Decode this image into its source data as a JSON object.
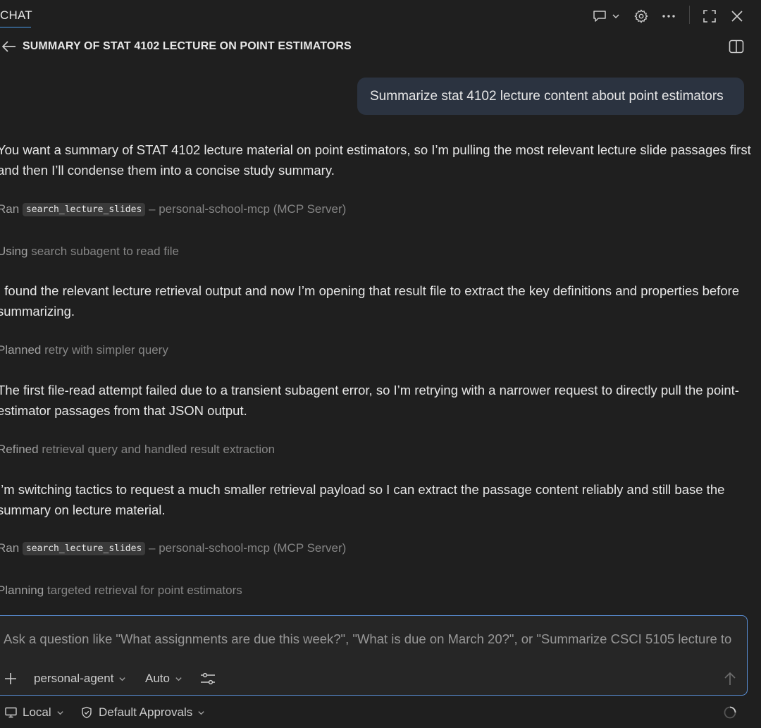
{
  "header": {
    "tab_label": "CHAT",
    "icons": [
      "chat-feedback-icon",
      "chevron-down-icon",
      "gear-icon",
      "more-icon",
      "fullscreen-icon",
      "close-icon"
    ]
  },
  "conversation": {
    "title": "SUMMARY OF STAT 4102 LECTURE ON POINT ESTIMATORS",
    "user_message": "Summarize stat 4102 lecture content about point estimators",
    "messages": [
      "You want a summary of STAT 4102 lecture material on point estimators, so I’m pulling the most relevant lecture slide passages first and then I’ll condense them into a concise study summary.",
      "I found the relevant lecture retrieval output and now I’m opening that result file to extract the key definitions and properties before summarizing.",
      "The first file-read attempt failed due to a transient subagent error, so I’m retrying with a narrower request to directly pull the point-estimator passages from that JSON output.",
      "I’m switching tactics to request a much smaller retrieval payload so I can extract the passage content reliably and still base the summary on lecture material."
    ],
    "steps": [
      {
        "verb": "Ran",
        "tool": "search_lecture_slides",
        "detail": "– personal-school-mcp (MCP Server)"
      },
      {
        "verb": "Using",
        "detail": "search subagent to read file"
      },
      {
        "verb": "Planned",
        "detail": "retry with simpler query"
      },
      {
        "verb": "Refined",
        "detail": "retrieval query and handled result extraction"
      },
      {
        "verb": "Ran",
        "tool": "search_lecture_slides",
        "detail": "– personal-school-mcp (MCP Server)"
      },
      {
        "verb": "Planning",
        "detail": "targeted retrieval for point estimators"
      }
    ]
  },
  "composer": {
    "placeholder": "Ask a question like \"What assignments are due this week?\", \"What is due on March 20?\", or \"Summarize CSCI 5105 lecture to",
    "agent": "personal-agent",
    "model": "Auto"
  },
  "footer": {
    "location": "Local",
    "approvals": "Default Approvals"
  }
}
